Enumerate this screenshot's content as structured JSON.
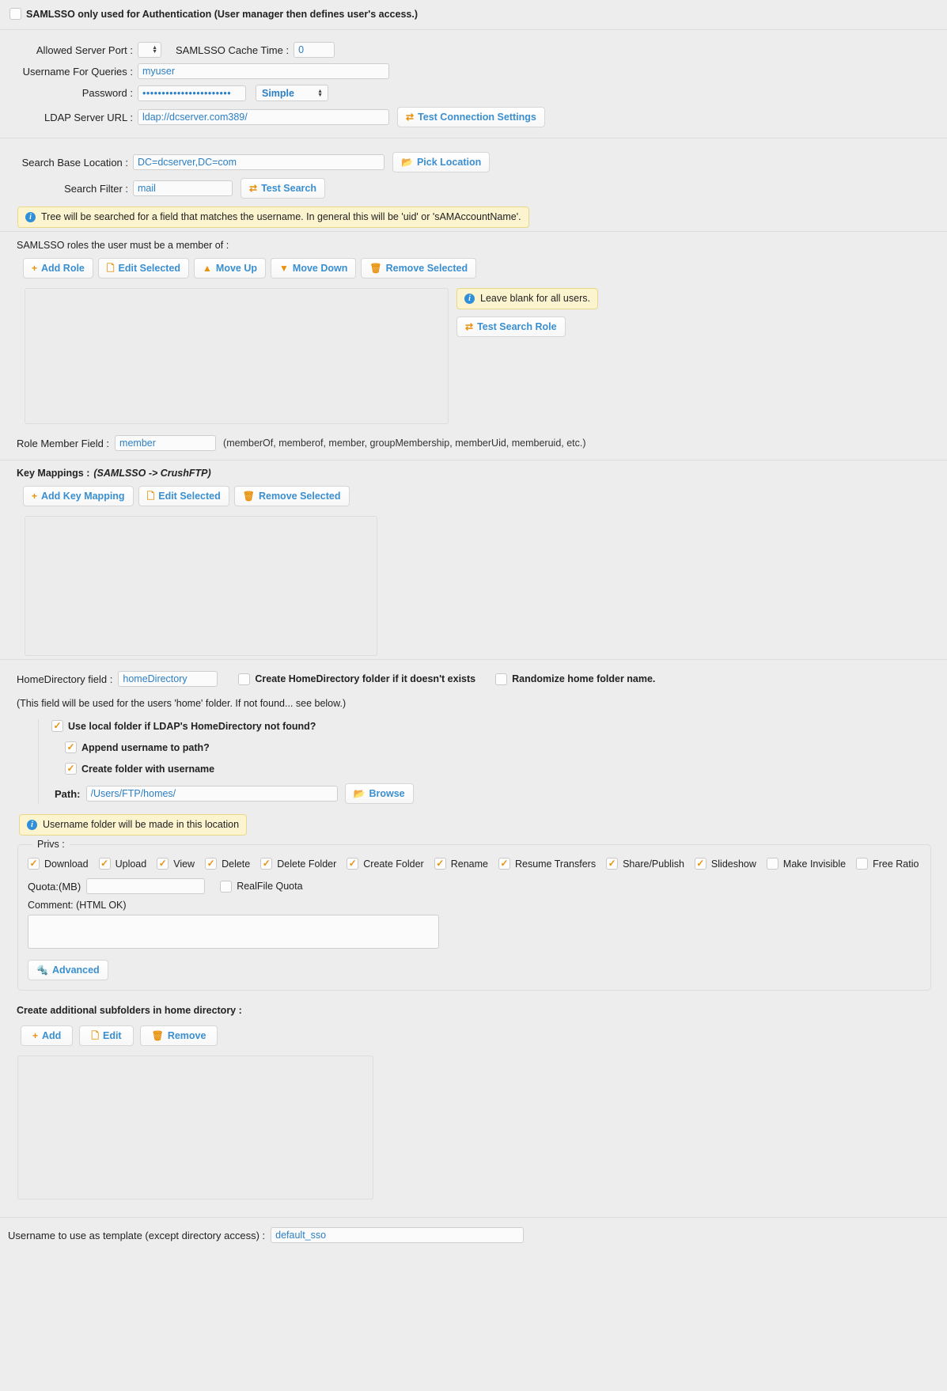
{
  "auth_only": {
    "label": "SAMLSSO only used for Authentication (User manager then defines user's access.)",
    "checked": false
  },
  "connection": {
    "allowed_server_port_label": "Allowed Server Port :",
    "allowed_server_port_value": "",
    "cache_time_label": "SAMLSSO Cache Time :",
    "cache_time_value": "0",
    "username_label": "Username For Queries :",
    "username_value": "myuser",
    "password_label": "Password :",
    "password_value": "•••••••••••••••••••••••",
    "auth_method_selected": "Simple",
    "auth_method_options": [
      "Simple"
    ],
    "ldap_url_label": "LDAP Server URL :",
    "ldap_url_value": "ldap://dcserver.com389/",
    "test_connection_label": "Test Connection Settings"
  },
  "search": {
    "base_location_label": "Search Base Location :",
    "base_location_value": "DC=dcserver,DC=com",
    "pick_location_label": "Pick Location",
    "filter_label": "Search Filter :",
    "filter_value": "mail",
    "test_search_label": "Test Search",
    "info": "Tree will be searched for a field that matches the username. In general this will be 'uid' or 'sAMAccountName'."
  },
  "roles": {
    "heading": "SAMLSSO roles the user must be a member of :",
    "buttons": [
      {
        "label": "Add Role",
        "icon": "plus-icon"
      },
      {
        "label": "Edit Selected",
        "icon": "document-icon"
      },
      {
        "label": "Move Up",
        "icon": "caret-up-icon"
      },
      {
        "label": "Move Down",
        "icon": "caret-down-icon"
      },
      {
        "label": "Remove Selected",
        "icon": "trash-icon"
      }
    ],
    "list_items": [],
    "info": "Leave blank for all users.",
    "test_search_role_label": "Test Search Role",
    "member_field_label": "Role Member Field :",
    "member_field_value": "member",
    "member_field_hint": "(memberOf, memberof, member, groupMembership, memberUid, memberuid, etc.)"
  },
  "key_mappings": {
    "heading": "Key Mappings :",
    "heading_italic": "(SAMLSSO -> CrushFTP)",
    "buttons": [
      {
        "label": "Add Key Mapping",
        "icon": "plus-icon"
      },
      {
        "label": "Edit Selected",
        "icon": "document-icon"
      },
      {
        "label": "Remove Selected",
        "icon": "trash-icon"
      }
    ],
    "list_items": []
  },
  "home_directory": {
    "field_label": "HomeDirectory field :",
    "field_value": "homeDirectory",
    "create_folder_label": "Create HomeDirectory folder if it doesn't exists",
    "create_folder_checked": false,
    "randomize_label": "Randomize home folder name.",
    "randomize_checked": false,
    "hint": "(This field will be used for the users 'home' folder. If not found... see below.)",
    "use_local_label": "Use local folder if LDAP's HomeDirectory not found?",
    "use_local_checked": true,
    "append_username_label": "Append username to path?",
    "append_username_checked": true,
    "create_with_username_label": "Create folder with username",
    "create_with_username_checked": true,
    "path_label": "Path:",
    "path_value": "/Users/FTP/homes/",
    "browse_label": "Browse",
    "info": "Username folder will be made in this location"
  },
  "privs": {
    "legend": "Privs :",
    "items": [
      {
        "label": "Download",
        "checked": true
      },
      {
        "label": "Upload",
        "checked": true
      },
      {
        "label": "View",
        "checked": true
      },
      {
        "label": "Delete",
        "checked": true
      },
      {
        "label": "Delete Folder",
        "checked": true
      },
      {
        "label": "Create Folder",
        "checked": true
      },
      {
        "label": "Rename",
        "checked": true
      },
      {
        "label": "Resume Transfers",
        "checked": true
      },
      {
        "label": "Share/Publish",
        "checked": true
      },
      {
        "label": "Slideshow",
        "checked": true
      },
      {
        "label": "Make Invisible",
        "checked": false
      },
      {
        "label": "Free Ratio",
        "checked": false
      }
    ],
    "quota_label": "Quota:(MB)",
    "quota_value": "",
    "realfile_quota_label": "RealFile Quota",
    "realfile_quota_checked": false,
    "comment_label": "Comment: (HTML OK)",
    "comment_value": "",
    "advanced_label": "Advanced"
  },
  "subfolders": {
    "heading": "Create additional subfolders in home directory :",
    "buttons": [
      {
        "label": "Add",
        "icon": "plus-icon"
      },
      {
        "label": "Edit",
        "icon": "document-icon"
      },
      {
        "label": "Remove",
        "icon": "trash-icon"
      }
    ],
    "list_items": []
  },
  "template": {
    "label": "Username to use as template (except directory access) :",
    "value": "default_sso"
  },
  "colors": {
    "accent_blue": "#3a8fd0",
    "icon_orange": "#e8920c",
    "info_bg": "#fcf3cf",
    "page_bg": "#ededed"
  }
}
